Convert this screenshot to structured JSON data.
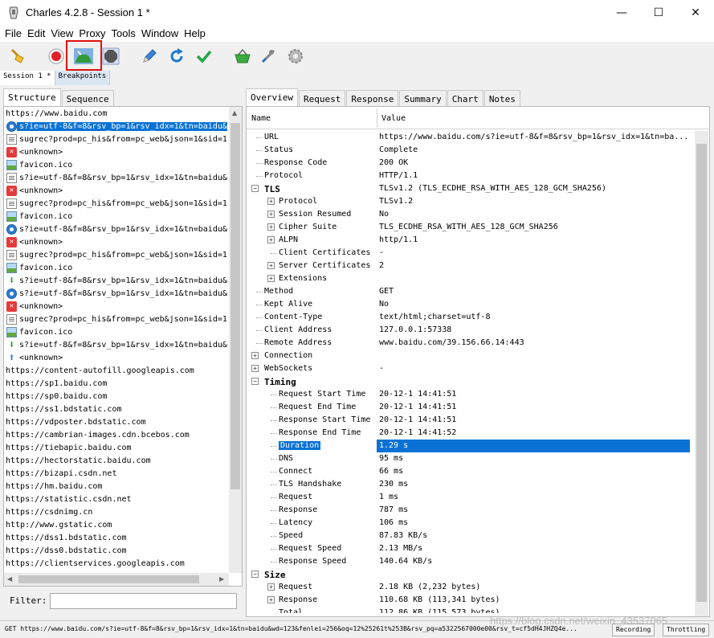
{
  "window": {
    "title": "Charles 4.2.8 - Session 1 *",
    "minimize": "—",
    "maximize": "☐",
    "close": "✕"
  },
  "menu": [
    "File",
    "Edit",
    "View",
    "Proxy",
    "Tools",
    "Window",
    "Help"
  ],
  "toolbar": {
    "buttons": [
      "broom-icon",
      "record-icon",
      "throttle-icon",
      "breakpoints-icon",
      "pen-icon",
      "refresh-icon",
      "check-icon",
      "basket-icon",
      "tools-icon",
      "settings-icon"
    ],
    "highlight_color": "#e01010"
  },
  "session_tabs": [
    "Session 1 *",
    "Breakpoints"
  ],
  "left": {
    "tabs": [
      "Structure",
      "Sequence"
    ],
    "tree": [
      {
        "icon": "none",
        "text": "https://www.baidu.com"
      },
      {
        "icon": "blue",
        "text": "s?ie=utf-8&f=8&rsv_bp=1&rsv_idx=1&tn=baidu&",
        "selected": true
      },
      {
        "icon": "doc",
        "text": "sugrec?prod=pc_his&from=pc_web&json=1&sid=1"
      },
      {
        "icon": "red",
        "text": "<unknown>"
      },
      {
        "icon": "img",
        "text": "favicon.ico"
      },
      {
        "icon": "doc",
        "text": "s?ie=utf-8&f=8&rsv_bp=1&rsv_idx=1&tn=baidu&"
      },
      {
        "icon": "red",
        "text": "<unknown>"
      },
      {
        "icon": "doc",
        "text": "sugrec?prod=pc_his&from=pc_web&json=1&sid=1"
      },
      {
        "icon": "img",
        "text": "favicon.ico"
      },
      {
        "icon": "blue",
        "text": "s?ie=utf-8&f=8&rsv_bp=1&rsv_idx=1&tn=baidu&"
      },
      {
        "icon": "red",
        "text": "<unknown>"
      },
      {
        "icon": "doc",
        "text": "sugrec?prod=pc_his&from=pc_web&json=1&sid=1"
      },
      {
        "icon": "img",
        "text": "favicon.ico"
      },
      {
        "icon": "down",
        "text": "s?ie=utf-8&f=8&rsv_bp=1&rsv_idx=1&tn=baidu&"
      },
      {
        "icon": "blue",
        "text": "s?ie=utf-8&f=8&rsv_bp=1&rsv_idx=1&tn=baidu&"
      },
      {
        "icon": "red",
        "text": "<unknown>"
      },
      {
        "icon": "doc",
        "text": "sugrec?prod=pc_his&from=pc_web&json=1&sid=1"
      },
      {
        "icon": "img",
        "text": "favicon.ico"
      },
      {
        "icon": "down",
        "text": "s?ie=utf-8&f=8&rsv_bp=1&rsv_idx=1&tn=baidu&"
      },
      {
        "icon": "up",
        "text": "<unknown>"
      },
      {
        "icon": "none",
        "text": "https://content-autofill.googleapis.com"
      },
      {
        "icon": "none",
        "text": "https://sp1.baidu.com"
      },
      {
        "icon": "none",
        "text": "https://sp0.baidu.com"
      },
      {
        "icon": "none",
        "text": "https://ss1.bdstatic.com"
      },
      {
        "icon": "none",
        "text": "https://vdposter.bdstatic.com"
      },
      {
        "icon": "none",
        "text": "https://cambrian-images.cdn.bcebos.com"
      },
      {
        "icon": "none",
        "text": "https://tiebapic.baidu.com"
      },
      {
        "icon": "none",
        "text": "https://hectorstatic.baidu.com"
      },
      {
        "icon": "none",
        "text": "https://bizapi.csdn.net"
      },
      {
        "icon": "none",
        "text": "https://hm.baidu.com"
      },
      {
        "icon": "none",
        "text": "https://statistic.csdn.net"
      },
      {
        "icon": "none",
        "text": "https://csdnimg.cn"
      },
      {
        "icon": "none",
        "text": "http://www.gstatic.com"
      },
      {
        "icon": "none",
        "text": "https://dss1.bdstatic.com"
      },
      {
        "icon": "none",
        "text": "https://dss0.bdstatic.com"
      },
      {
        "icon": "none",
        "text": "https://clientservices.googleapis.com"
      }
    ],
    "filter_label": "Filter:",
    "filter_value": ""
  },
  "right": {
    "tabs": [
      "Overview",
      "Request",
      "Response",
      "Summary",
      "Chart",
      "Notes"
    ],
    "col_name": "Name",
    "col_value": "Value",
    "rows": [
      {
        "d": 1,
        "n": "URL",
        "v": "https://www.baidu.com/s?ie=utf-8&f=8&rsv_bp=1&rsv_idx=1&tn=ba..."
      },
      {
        "d": 1,
        "n": "Status",
        "v": "Complete"
      },
      {
        "d": 1,
        "n": "Response Code",
        "v": "200 OK"
      },
      {
        "d": 1,
        "n": "Protocol",
        "v": "HTTP/1.1"
      },
      {
        "d": 0,
        "n": "TLS",
        "v": "TLSv1.2 (TLS_ECDHE_RSA_WITH_AES_128_GCM_SHA256)",
        "exp": "-",
        "bold": true
      },
      {
        "d": 2,
        "n": "Protocol",
        "v": "TLSv1.2",
        "exp": "+"
      },
      {
        "d": 2,
        "n": "Session Resumed",
        "v": "No",
        "exp": "+"
      },
      {
        "d": 2,
        "n": "Cipher Suite",
        "v": "TLS_ECDHE_RSA_WITH_AES_128_GCM_SHA256",
        "exp": "+"
      },
      {
        "d": 2,
        "n": "ALPN",
        "v": "http/1.1",
        "exp": "+"
      },
      {
        "d": 2,
        "n": "Client Certificates",
        "v": "-"
      },
      {
        "d": 2,
        "n": "Server Certificates",
        "v": "2",
        "exp": "+"
      },
      {
        "d": 2,
        "n": "Extensions",
        "v": "",
        "exp": "+"
      },
      {
        "d": 1,
        "n": "Method",
        "v": "GET"
      },
      {
        "d": 1,
        "n": "Kept Alive",
        "v": "No"
      },
      {
        "d": 1,
        "n": "Content-Type",
        "v": "text/html;charset=utf-8"
      },
      {
        "d": 1,
        "n": "Client Address",
        "v": "127.0.0.1:57338"
      },
      {
        "d": 1,
        "n": "Remote Address",
        "v": "www.baidu.com/39.156.66.14:443"
      },
      {
        "d": 0,
        "n": "Connection",
        "v": "",
        "exp": "+"
      },
      {
        "d": 0,
        "n": "WebSockets",
        "v": "-",
        "exp": "+"
      },
      {
        "d": 0,
        "n": "Timing",
        "v": "",
        "exp": "-",
        "bold": true
      },
      {
        "d": 2,
        "n": "Request Start Time",
        "v": "20-12-1 14:41:51"
      },
      {
        "d": 2,
        "n": "Request End Time",
        "v": "20-12-1 14:41:51"
      },
      {
        "d": 2,
        "n": "Response Start Time",
        "v": "20-12-1 14:41:51"
      },
      {
        "d": 2,
        "n": "Response End Time",
        "v": "20-12-1 14:41:52"
      },
      {
        "d": 2,
        "n": "Duration",
        "v": "1.29 s",
        "hl": true
      },
      {
        "d": 2,
        "n": "DNS",
        "v": "95 ms"
      },
      {
        "d": 2,
        "n": "Connect",
        "v": "66 ms"
      },
      {
        "d": 2,
        "n": "TLS Handshake",
        "v": "230 ms"
      },
      {
        "d": 2,
        "n": "Request",
        "v": "1 ms"
      },
      {
        "d": 2,
        "n": "Response",
        "v": "787 ms"
      },
      {
        "d": 2,
        "n": "Latency",
        "v": "106 ms"
      },
      {
        "d": 2,
        "n": "Speed",
        "v": "87.83 KB/s"
      },
      {
        "d": 2,
        "n": "Request Speed",
        "v": "2.13 MB/s"
      },
      {
        "d": 2,
        "n": "Response Speed",
        "v": "140.64 KB/s"
      },
      {
        "d": 0,
        "n": "Size",
        "v": "",
        "exp": "-",
        "bold": true
      },
      {
        "d": 2,
        "n": "Request",
        "v": "2.18 KB (2,232 bytes)",
        "exp": "+"
      },
      {
        "d": 2,
        "n": "Response",
        "v": "110.68 KB (113,341 bytes)",
        "exp": "+"
      },
      {
        "d": 2,
        "n": "Total",
        "v": "112.86 KB (115,573 bytes)"
      }
    ]
  },
  "status": {
    "text": "GET https://www.baidu.com/s?ie=utf-8&f=8&rsv_bp=1&rsv_idx=1&tn=baidu&wd=123&fenlei=256&oq=12%25261t%253B&rsv_pq=a5322567000e00&rsv_t=cf5dH4JHZQ4e...",
    "recording": "Recording",
    "throttling": "Throttling"
  },
  "watermark": "https://blog.csdn.net/weixin_43537065"
}
